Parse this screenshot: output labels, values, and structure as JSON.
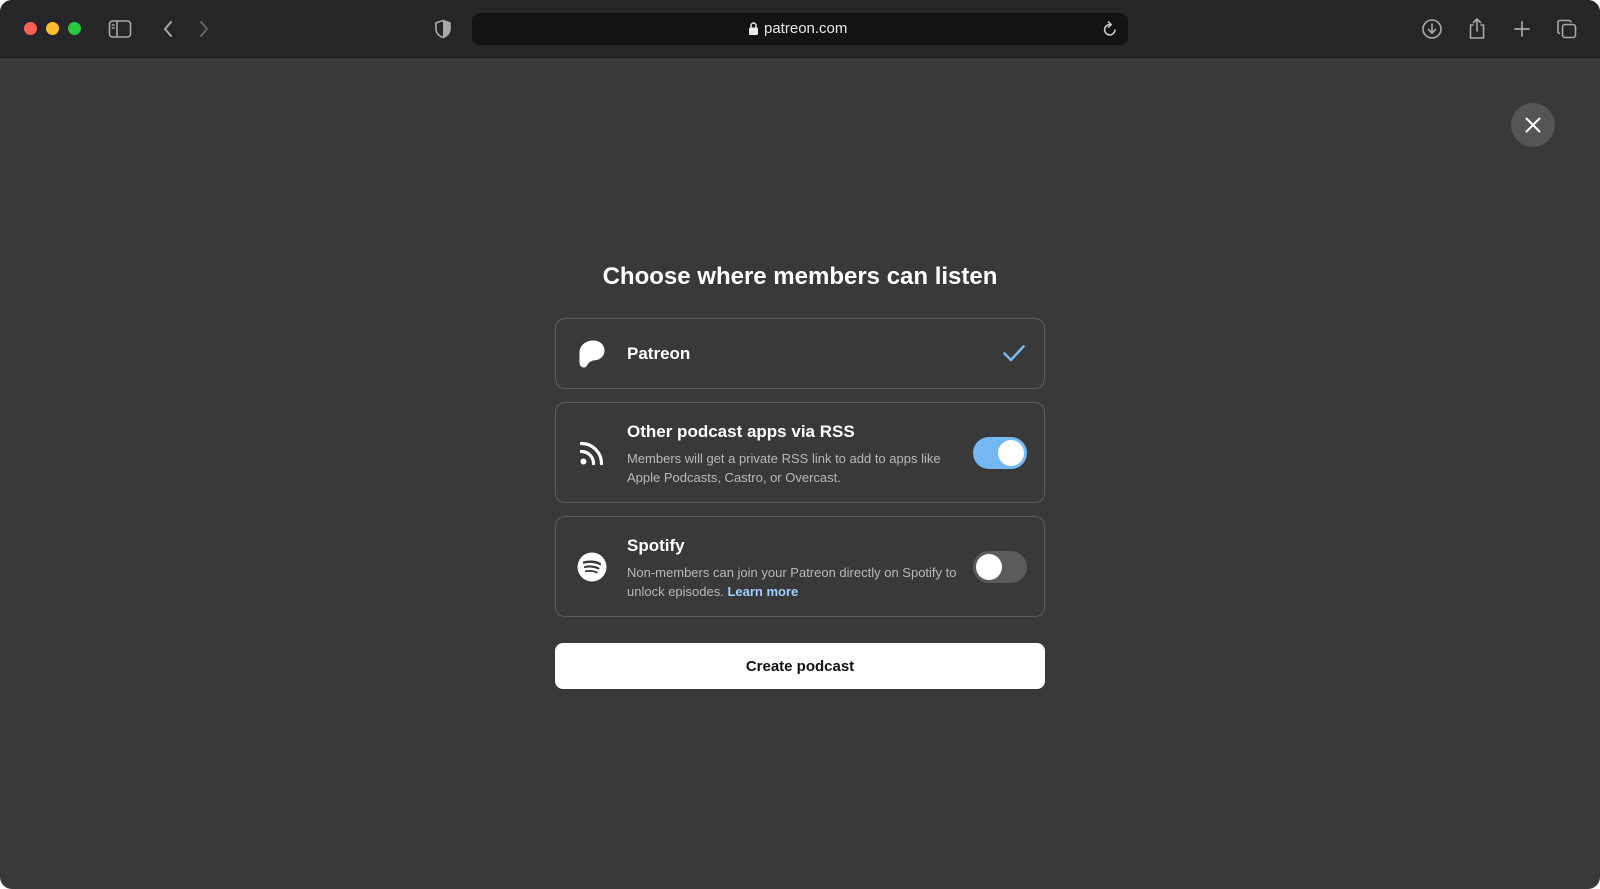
{
  "browser": {
    "url": "patreon.com",
    "icons": [
      "sidebar-icon",
      "back-icon",
      "forward-icon",
      "shield-icon",
      "lock-icon",
      "reload-icon",
      "download-icon",
      "share-icon",
      "new-tab-icon",
      "tabs-overview-icon"
    ]
  },
  "modal": {
    "title": "Choose where members can listen",
    "options": [
      {
        "id": "patreon",
        "label": "Patreon",
        "icon": "patreon-logo-icon",
        "selected": true
      },
      {
        "id": "rss",
        "label": "Other podcast apps via RSS",
        "description": "Members will get a private RSS link to add to apps like Apple Podcasts, Castro, or Overcast.",
        "icon": "rss-icon",
        "enabled": true
      },
      {
        "id": "spotify",
        "label": "Spotify",
        "description": "Non-members can join your Patreon directly on Spotify to unlock episodes.",
        "link_text": "Learn more",
        "icon": "spotify-icon",
        "enabled": false
      }
    ],
    "create_label": "Create podcast"
  },
  "colors": {
    "background": "#393939",
    "toolbar": "#262628",
    "accent": "#74b8f2",
    "link": "#9ed0ff"
  }
}
